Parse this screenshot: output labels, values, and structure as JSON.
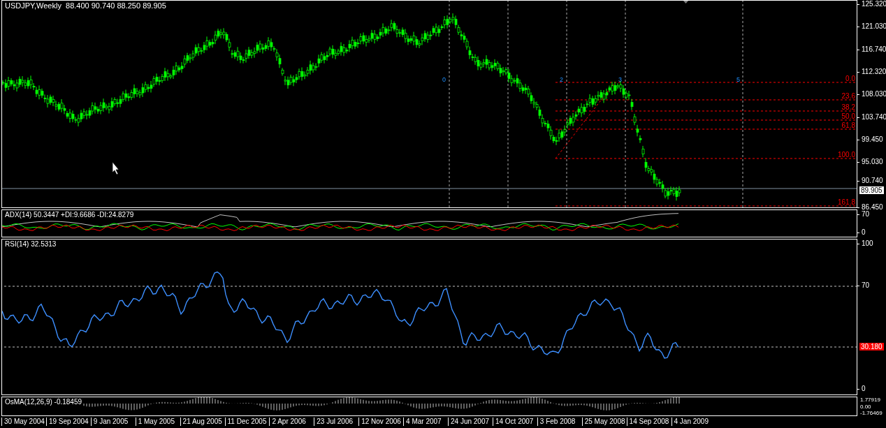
{
  "chart": {
    "symbol": "USDJPY,Weekly",
    "ohlc": "88.400 90.740 88.250 89.905"
  },
  "price_axis": [
    "125.320",
    "121.030",
    "116.740",
    "112.320",
    "108.030",
    "103.740",
    "99.450",
    "95.030",
    "90.740",
    "86.450"
  ],
  "current_price": "89.905",
  "fibonacci_levels": [
    {
      "label": "0.0"
    },
    {
      "label": "23.6"
    },
    {
      "label": "38.2"
    },
    {
      "label": "50.0"
    },
    {
      "label": "61.8"
    },
    {
      "label": "100.0"
    },
    {
      "label": "161.8"
    }
  ],
  "wave_labels": [
    "0",
    "2",
    "3",
    "5"
  ],
  "adx_panel": {
    "label": "ADX(14) 50.3447 +DI:9.6686 -DI:24.8279",
    "axis": [
      "70",
      "0"
    ]
  },
  "rsi_panel": {
    "label": "RSI(14) 32.5313",
    "axis": [
      "100",
      "70",
      "0"
    ],
    "current": "30.180"
  },
  "osma_panel": {
    "label": "OsMA(12,26,9) -0.18459",
    "axis": [
      "1.77919",
      "0.00",
      "-1.76469"
    ]
  },
  "dates": [
    "30 May 2004",
    "19 Sep 2004",
    "9 Jan 2005",
    "1 May 2005",
    "21 Aug 2005",
    "11 Dec 2005",
    "2 Apr 2006",
    "23 Jul 2006",
    "12 Nov 2006",
    "4 Mar 2007",
    "24 Jun 2007",
    "14 Oct 2007",
    "3 Feb 2008",
    "25 May 2008",
    "14 Sep 2008",
    "4 Jan 2009"
  ]
}
